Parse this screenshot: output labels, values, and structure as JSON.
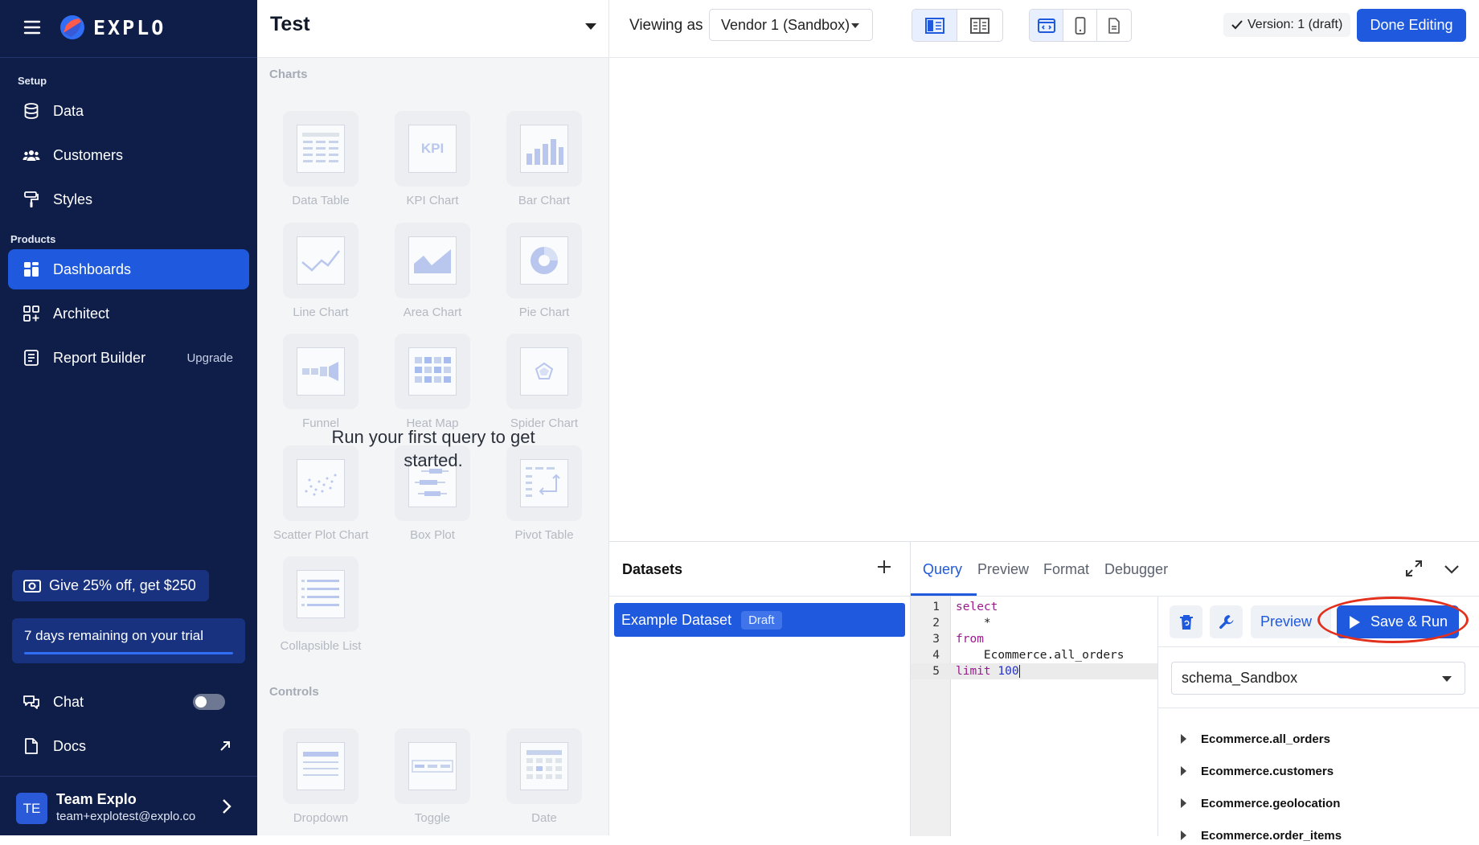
{
  "sidebar": {
    "brand": "EXPLO",
    "sections": {
      "setup": "Setup",
      "products": "Products"
    },
    "setup_items": [
      {
        "label": "Data",
        "icon": "database-icon"
      },
      {
        "label": "Customers",
        "icon": "users-icon"
      },
      {
        "label": "Styles",
        "icon": "paint-roller-icon"
      }
    ],
    "product_items": [
      {
        "label": "Dashboards",
        "icon": "dashboard-icon",
        "active": true
      },
      {
        "label": "Architect",
        "icon": "architect-icon"
      },
      {
        "label": "Report Builder",
        "icon": "report-icon",
        "extra": "Upgrade"
      }
    ],
    "promo": "Give 25% off, get $250",
    "trial": "7 days remaining on your trial",
    "chat": "Chat",
    "docs": "Docs",
    "user": {
      "initials": "TE",
      "name": "Team Explo",
      "email": "team+explotest@explo.co"
    }
  },
  "component_panel": {
    "title": "Test",
    "charts_label": "Charts",
    "controls_label": "Controls",
    "charts": [
      "Data Table",
      "KPI Chart",
      "Bar Chart",
      "Line Chart",
      "Area Chart",
      "Pie Chart",
      "Funnel",
      "Heat Map",
      "Spider Chart",
      "Scatter Plot Chart",
      "Box Plot",
      "Pivot Table",
      "Collapsible List"
    ],
    "kpi_text": "KPI",
    "controls": [
      "Dropdown",
      "Toggle",
      "Date"
    ],
    "empty_message": "Run your first query to get started."
  },
  "topbar": {
    "viewing_as": "Viewing as",
    "vendor": "Vendor 1 (Sandbox)",
    "version": "Version: 1 (draft)",
    "done": "Done Editing"
  },
  "editor": {
    "datasets_title": "Datasets",
    "dataset": {
      "name": "Example Dataset",
      "badge": "Draft"
    },
    "tabs": [
      "Query",
      "Preview",
      "Format",
      "Debugger"
    ],
    "active_tab": "Query",
    "code": [
      {
        "n": "1",
        "kw": "select",
        "rest": ""
      },
      {
        "n": "2",
        "kw": "",
        "rest": "    *"
      },
      {
        "n": "3",
        "kw": "from",
        "rest": ""
      },
      {
        "n": "4",
        "kw": "",
        "rest": "    Ecommerce.all_orders"
      },
      {
        "n": "5",
        "kw": "limit",
        "rest": " ",
        "num": "100"
      }
    ],
    "preview_btn": "Preview",
    "save_run_btn": "Save & Run",
    "schema": "schema_Sandbox",
    "tables": [
      "Ecommerce.all_orders",
      "Ecommerce.customers",
      "Ecommerce.geolocation",
      "Ecommerce.order_items"
    ]
  },
  "colors": {
    "sidebar_bg": "#0f1e48",
    "accent": "#1f59dd",
    "highlight": "#e2301d"
  }
}
